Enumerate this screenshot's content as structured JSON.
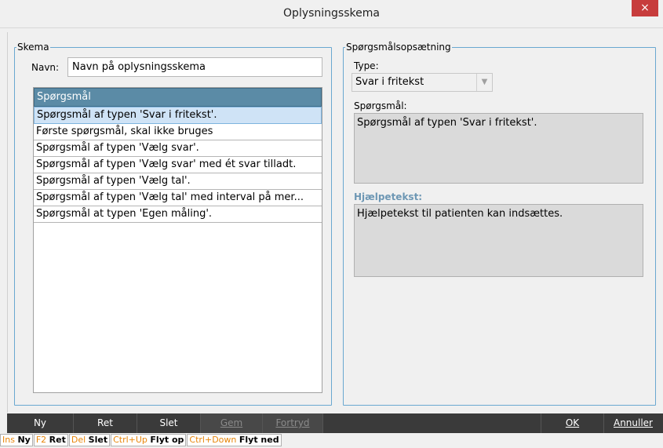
{
  "window": {
    "title": "Oplysningsskema",
    "close": "×"
  },
  "schema": {
    "legend": "Skema",
    "name_label": "Navn:",
    "name_value": "Navn på oplysningsskema",
    "list_header": "Spørgsmål",
    "questions": [
      "Spørgsmål af typen 'Svar i fritekst'.",
      "Første spørgsmål, skal ikke bruges",
      "Spørgsmål af typen 'Vælg svar'.",
      "Spørgsmål af typen 'Vælg svar' med ét svar tilladt.",
      "Spørgsmål af typen 'Vælg tal'.",
      "Spørgsmål af typen 'Vælg tal' med interval på mer...",
      "Spørgsmål at typen 'Egen måling'."
    ]
  },
  "setup": {
    "legend": "Spørgsmålsopsætning",
    "type_label": "Type:",
    "type_value": "Svar i fritekst",
    "question_label": "Spørgsmål:",
    "question_value": "Spørgsmål af typen 'Svar i fritekst'.",
    "help_label": "Hjælpetekst:",
    "help_value": "Hjælpetekst til patienten kan indsættes."
  },
  "toolbar": {
    "new": "Ny",
    "edit": "Ret",
    "delete": "Slet",
    "save": "Gem",
    "undo": "Fortryd",
    "ok": "OK",
    "cancel": "Annuller"
  },
  "shortcuts": [
    {
      "key": "Ins",
      "action": "Ny"
    },
    {
      "key": "F2",
      "action": "Ret"
    },
    {
      "key": "Del",
      "action": "Slet"
    },
    {
      "key": "Ctrl+Up",
      "action": "Flyt op"
    },
    {
      "key": "Ctrl+Down",
      "action": "Flyt ned"
    }
  ],
  "colors": {
    "accent": "#5b8ba6",
    "close": "#c73c3c",
    "shortcut_key": "#e8860a"
  }
}
